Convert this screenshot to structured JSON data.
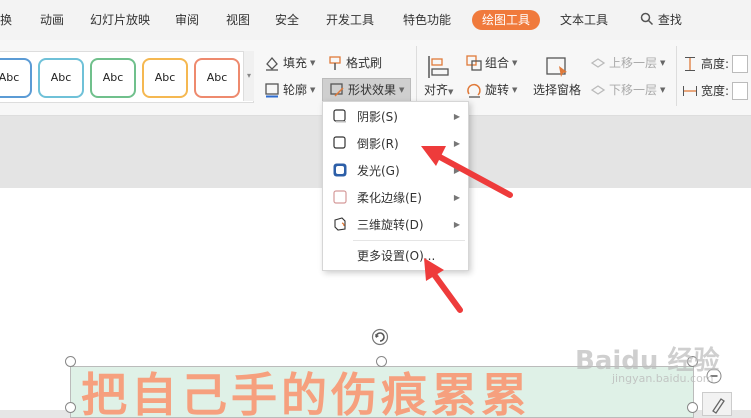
{
  "tabs": [
    {
      "label": "换"
    },
    {
      "label": "动画"
    },
    {
      "label": "幻灯片放映"
    },
    {
      "label": "审阅"
    },
    {
      "label": "视图"
    },
    {
      "label": "安全"
    },
    {
      "label": "开发工具"
    },
    {
      "label": "特色功能"
    },
    {
      "label": "绘图工具"
    },
    {
      "label": "文本工具"
    },
    {
      "label": "查找"
    }
  ],
  "gallery": {
    "items": [
      {
        "label": "Abc",
        "border": "#5b9bd5"
      },
      {
        "label": "Abc",
        "border": "#6fc1d8"
      },
      {
        "label": "Abc",
        "border": "#70c08c"
      },
      {
        "label": "Abc",
        "border": "#f5b851"
      },
      {
        "label": "Abc",
        "border": "#ee8a6e"
      }
    ]
  },
  "ribbon": {
    "fill": "填充",
    "format_painter": "格式刷",
    "outline": "轮廓",
    "shape_effect": "形状效果",
    "align": "对齐",
    "group": "组合",
    "rotate": "旋转",
    "selection_pane": "选择窗格",
    "bring_forward": "上移一层",
    "send_backward": "下移一层",
    "height": "高度:",
    "width": "宽度:"
  },
  "menu": {
    "items": [
      {
        "label": "阴影(S)",
        "icon": "shadow-icon"
      },
      {
        "label": "倒影(R)",
        "icon": "reflection-icon"
      },
      {
        "label": "发光(G)",
        "icon": "glow-icon"
      },
      {
        "label": "柔化边缘(E)",
        "icon": "soft-edge-icon"
      },
      {
        "label": "三维旋转(D)",
        "icon": "3d-rotation-icon"
      }
    ],
    "more": "更多设置(O)..."
  },
  "slide": {
    "text": "把自己手的伤痕累累"
  },
  "watermark": {
    "brand": "Baidu 经验",
    "url": "jingyan.baidu.com"
  },
  "colors": {
    "accent": "#f07a3c",
    "arrow": "#ee3b3b"
  }
}
